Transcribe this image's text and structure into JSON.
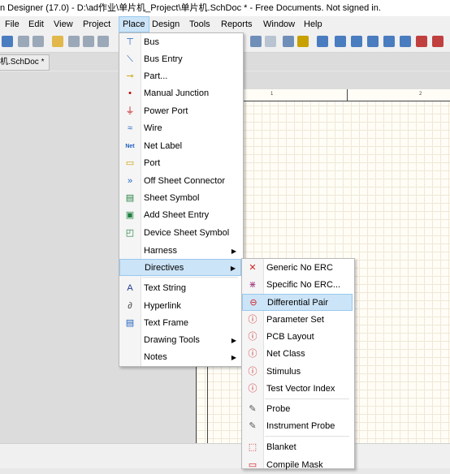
{
  "window_title": "n Designer (17.0) - D:\\ad作业\\单片机_Project\\单片机.SchDoc * - Free Documents. Not signed in.",
  "menubar": [
    "File",
    "Edit",
    "View",
    "Project",
    "Place",
    "Design",
    "Tools",
    "Reports",
    "Window",
    "Help"
  ],
  "doc_tab": "机.SchDoc *",
  "ruler": [
    "1",
    "2"
  ],
  "place_menu": [
    {
      "label": "Bus",
      "icon": "bus-icon",
      "glyph": "⊤",
      "color": "#2060c0"
    },
    {
      "label": "Bus Entry",
      "icon": "bus-entry-icon",
      "glyph": "⟍",
      "color": "#2060c0"
    },
    {
      "label": "Part...",
      "icon": "part-icon",
      "glyph": "⊸",
      "color": "#c8a000"
    },
    {
      "label": "Manual Junction",
      "icon": "junction-icon",
      "glyph": "•",
      "color": "#c00000"
    },
    {
      "label": "Power Port",
      "icon": "power-port-icon",
      "glyph": "⏚",
      "color": "#c00000"
    },
    {
      "label": "Wire",
      "icon": "wire-icon",
      "glyph": "≈",
      "color": "#2060c0"
    },
    {
      "label": "Net Label",
      "icon": "net-label-icon",
      "glyph": "Net",
      "color": "#2060c0"
    },
    {
      "label": "Port",
      "icon": "port-icon",
      "glyph": "▭",
      "color": "#c8a000"
    },
    {
      "label": "Off Sheet Connector",
      "icon": "off-sheet-connector-icon",
      "glyph": "»",
      "color": "#2060c0"
    },
    {
      "label": "Sheet Symbol",
      "icon": "sheet-symbol-icon",
      "glyph": "▤",
      "color": "#208040"
    },
    {
      "label": "Add Sheet Entry",
      "icon": "sheet-entry-icon",
      "glyph": "▣",
      "color": "#208040"
    },
    {
      "label": "Device Sheet Symbol",
      "icon": "device-sheet-icon",
      "glyph": "◰",
      "color": "#208040"
    },
    {
      "label": "Harness",
      "icon": "",
      "glyph": "",
      "color": "#000",
      "submenu": true
    },
    {
      "label": "Directives",
      "icon": "",
      "glyph": "",
      "color": "#000",
      "submenu": true,
      "highlight": true
    },
    {
      "label": "Text String",
      "icon": "text-string-icon",
      "glyph": "A",
      "color": "#1a3a8a"
    },
    {
      "label": "Hyperlink",
      "icon": "hyperlink-icon",
      "glyph": "∂",
      "color": "#444"
    },
    {
      "label": "Text Frame",
      "icon": "text-frame-icon",
      "glyph": "▤",
      "color": "#2060c0"
    },
    {
      "label": "Drawing Tools",
      "icon": "",
      "glyph": "",
      "color": "#000",
      "submenu": true
    },
    {
      "label": "Notes",
      "icon": "",
      "glyph": "",
      "color": "#000",
      "submenu": true
    }
  ],
  "directives_menu": [
    {
      "label": "Generic No ERC",
      "icon": "no-erc-icon",
      "glyph": "✕",
      "color": "#d02020"
    },
    {
      "label": "Specific No ERC...",
      "icon": "specific-no-erc-icon",
      "glyph": "⋇",
      "color": "#a04080"
    },
    {
      "label": "Differential Pair",
      "icon": "differential-pair-icon",
      "glyph": "⊖",
      "color": "#d02020",
      "highlight": true
    },
    {
      "label": "Parameter Set",
      "icon": "parameter-set-icon",
      "glyph": "ⓘ",
      "color": "#d02020"
    },
    {
      "label": "PCB Layout",
      "icon": "pcb-layout-icon",
      "glyph": "ⓘ",
      "color": "#d02020"
    },
    {
      "label": "Net Class",
      "icon": "net-class-icon",
      "glyph": "ⓘ",
      "color": "#d02020"
    },
    {
      "label": "Stimulus",
      "icon": "stimulus-icon",
      "glyph": "ⓘ",
      "color": "#d02020"
    },
    {
      "label": "Test Vector Index",
      "icon": "test-vector-icon",
      "glyph": "ⓘ",
      "color": "#d02020"
    },
    {
      "label": "Probe",
      "icon": "probe-icon",
      "glyph": "✎",
      "color": "#555"
    },
    {
      "label": "Instrument Probe",
      "icon": "instrument-probe-icon",
      "glyph": "✎",
      "color": "#555"
    },
    {
      "label": "Blanket",
      "icon": "blanket-icon",
      "glyph": "⬚",
      "color": "#d02020"
    },
    {
      "label": "Compile Mask",
      "icon": "compile-mask-icon",
      "glyph": "▭",
      "color": "#d02020"
    }
  ]
}
